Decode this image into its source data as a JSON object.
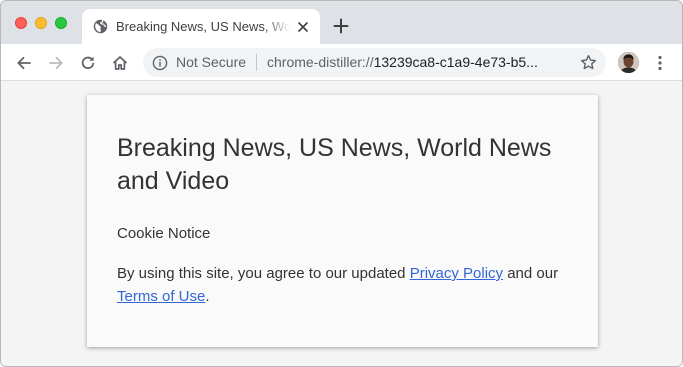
{
  "browser": {
    "tab": {
      "title": "Breaking News, US News, World News and Video"
    },
    "toolbar": {
      "security_label": "Not Secure",
      "url_scheme": "chrome-distiller://",
      "url_rest": "13239ca8-c1a9-4e73-b5..."
    },
    "colors": {
      "tabstrip": "#dee1e6",
      "close": "#fe5f57",
      "minimize": "#febc2e",
      "maximize": "#28c840",
      "link": "#3367d6"
    },
    "icons": [
      "globe-icon",
      "close-icon",
      "plus-icon",
      "back-arrow-icon",
      "forward-arrow-icon",
      "reload-icon",
      "home-icon",
      "info-icon",
      "star-icon",
      "avatar",
      "menu-dots-icon"
    ]
  },
  "article": {
    "title": "Breaking News, US News, World News and Video",
    "subheading": "Cookie Notice",
    "text_before": "By using this site, you agree to our updated ",
    "privacy_link": "Privacy Policy",
    "text_middle": " and our ",
    "terms_link": "Terms of Use",
    "text_after": "."
  }
}
